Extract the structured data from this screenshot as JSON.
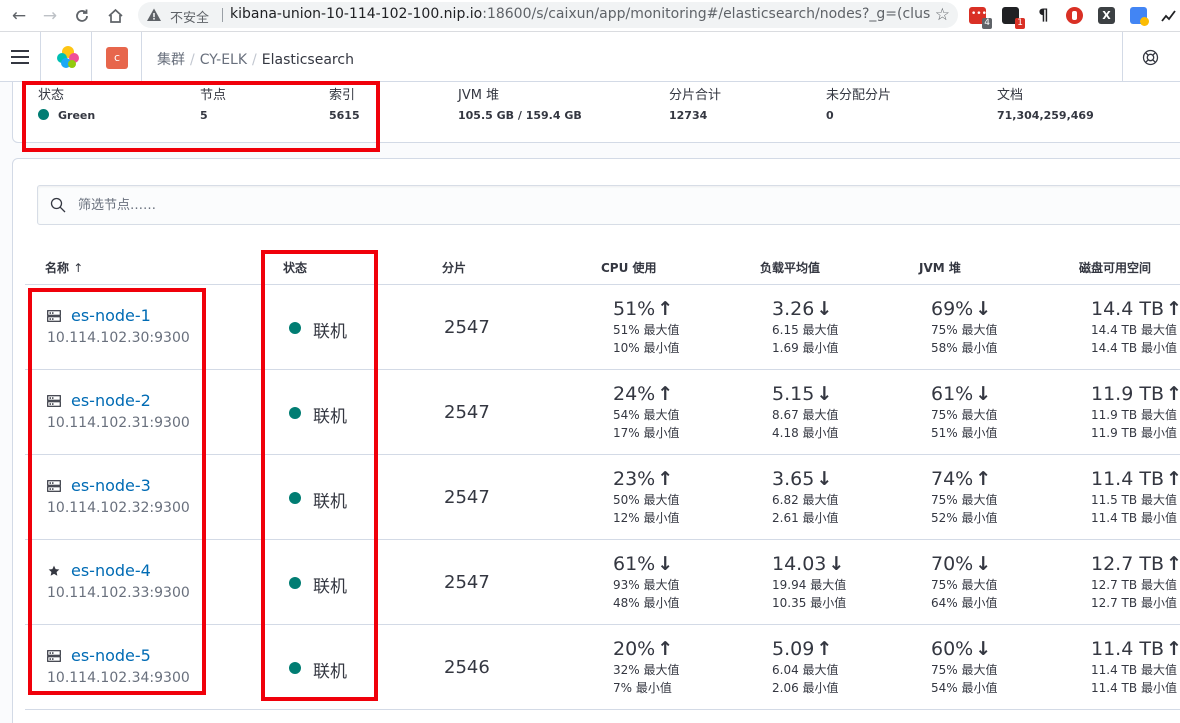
{
  "browser": {
    "not_secure": "不安全",
    "url_host": "kibana-union-10-114-102-100.nip.io",
    "url_rest": ":18600/s/caixun/app/monitoring#/elasticsearch/nodes?_g=(clus...",
    "ext_badge_1": "4",
    "ext_badge_2": "1"
  },
  "header": {
    "space_initial": "c",
    "breadcrumbs": [
      "集群",
      "CY-ELK",
      "Elasticsearch"
    ]
  },
  "cluster_status": {
    "status": {
      "title": "状态",
      "value": "Green"
    },
    "nodes": {
      "title": "节点",
      "value": "5"
    },
    "indices": {
      "title": "索引",
      "value": "5615"
    },
    "jvm_heap": {
      "title": "JVM 堆",
      "value": "105.5 GB / 159.4 GB"
    },
    "total_shards": {
      "title": "分片合计",
      "value": "12734"
    },
    "unassigned_shards": {
      "title": "未分配分片",
      "value": "0"
    },
    "documents": {
      "title": "文档",
      "value": "71,304,259,469"
    }
  },
  "filter": {
    "placeholder": "筛选节点……"
  },
  "table": {
    "columns": {
      "name": "名称",
      "sort_indicator": "↑",
      "status": "状态",
      "shards": "分片",
      "cpu": "CPU 使用",
      "load": "负载平均值",
      "jvm": "JVM 堆",
      "disk": "磁盘可用空间"
    },
    "max_label": "最大值",
    "min_label": "最小值",
    "rows": [
      {
        "name": "es-node-1",
        "address": "10.114.102.30:9300",
        "icon": "node-icon",
        "status": "联机",
        "shards": "2547",
        "cpu": {
          "value": "51%",
          "trend": "↑",
          "max": "51%",
          "min": "10%"
        },
        "load": {
          "value": "3.26",
          "trend": "↓",
          "max": "6.15",
          "min": "1.69"
        },
        "jvm": {
          "value": "69%",
          "trend": "↓",
          "max": "75%",
          "min": "58%"
        },
        "disk": {
          "value": "14.4 TB",
          "trend": "↑",
          "max": "14.4 TB",
          "min": "14.4 TB"
        }
      },
      {
        "name": "es-node-2",
        "address": "10.114.102.31:9300",
        "icon": "node-icon",
        "status": "联机",
        "shards": "2547",
        "cpu": {
          "value": "24%",
          "trend": "↑",
          "max": "54%",
          "min": "17%"
        },
        "load": {
          "value": "5.15",
          "trend": "↓",
          "max": "8.67",
          "min": "4.18"
        },
        "jvm": {
          "value": "61%",
          "trend": "↓",
          "max": "75%",
          "min": "51%"
        },
        "disk": {
          "value": "11.9 TB",
          "trend": "↑",
          "max": "11.9 TB",
          "min": "11.9 TB"
        }
      },
      {
        "name": "es-node-3",
        "address": "10.114.102.32:9300",
        "icon": "node-icon",
        "status": "联机",
        "shards": "2547",
        "cpu": {
          "value": "23%",
          "trend": "↑",
          "max": "50%",
          "min": "12%"
        },
        "load": {
          "value": "3.65",
          "trend": "↓",
          "max": "6.82",
          "min": "2.61"
        },
        "jvm": {
          "value": "74%",
          "trend": "↑",
          "max": "75%",
          "min": "52%"
        },
        "disk": {
          "value": "11.4 TB",
          "trend": "↑",
          "max": "11.5 TB",
          "min": "11.4 TB"
        }
      },
      {
        "name": "es-node-4",
        "address": "10.114.102.33:9300",
        "icon": "star-icon",
        "status": "联机",
        "shards": "2547",
        "cpu": {
          "value": "61%",
          "trend": "↓",
          "max": "93%",
          "min": "48%"
        },
        "load": {
          "value": "14.03",
          "trend": "↓",
          "max": "19.94",
          "min": "10.35"
        },
        "jvm": {
          "value": "70%",
          "trend": "↓",
          "max": "75%",
          "min": "64%"
        },
        "disk": {
          "value": "12.7 TB",
          "trend": "↑",
          "max": "12.7 TB",
          "min": "12.7 TB"
        }
      },
      {
        "name": "es-node-5",
        "address": "10.114.102.34:9300",
        "icon": "node-icon",
        "status": "联机",
        "shards": "2546",
        "cpu": {
          "value": "20%",
          "trend": "↑",
          "max": "32%",
          "min": "7%"
        },
        "load": {
          "value": "5.09",
          "trend": "↑",
          "max": "6.04",
          "min": "2.06"
        },
        "jvm": {
          "value": "60%",
          "trend": "↓",
          "max": "75%",
          "min": "54%"
        },
        "disk": {
          "value": "11.4 TB",
          "trend": "↑",
          "max": "11.4 TB",
          "min": "11.4 TB"
        }
      }
    ]
  },
  "colors": {
    "accent_red_box": "#f0000a",
    "status_green": "#017d73",
    "link_blue": "#006bb4",
    "space_avatar": "#e7664c"
  }
}
